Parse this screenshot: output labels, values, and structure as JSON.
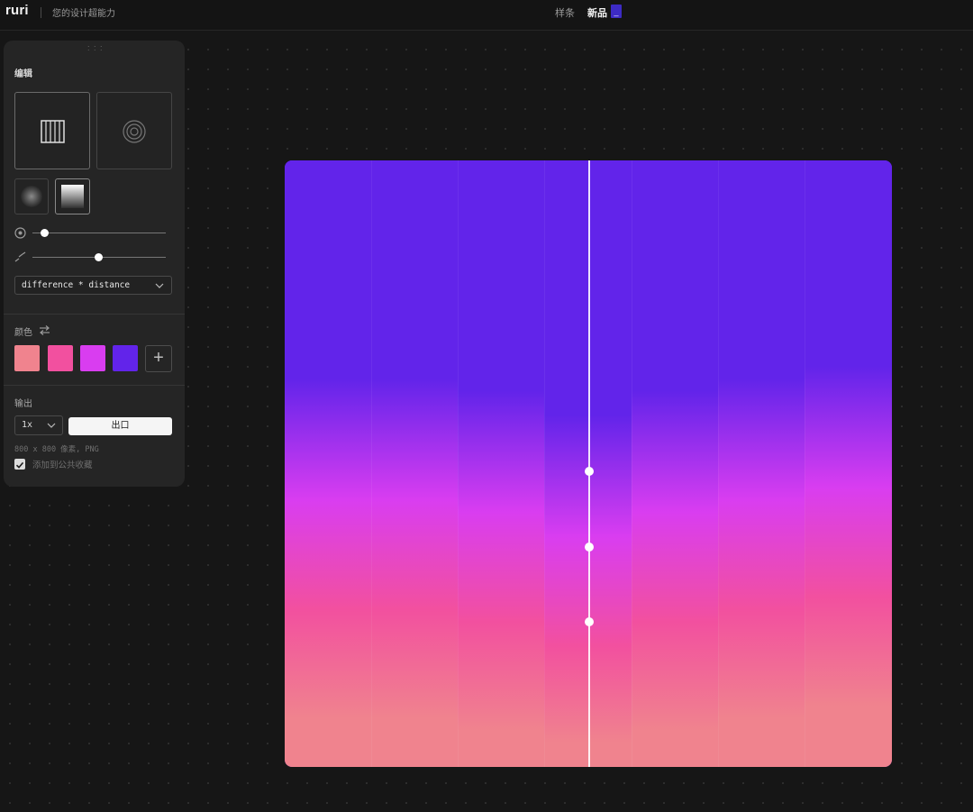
{
  "header": {
    "logo": "ruri",
    "tagline": "您的设计超能力",
    "nav": [
      {
        "label": "样条"
      },
      {
        "label": "新品"
      }
    ],
    "badge": "_"
  },
  "panel": {
    "edit_title": "编辑",
    "modes": [
      {
        "name": "vertical-strips-icon",
        "active": true
      },
      {
        "name": "concentric-rings-icon",
        "active": false
      }
    ],
    "textures": [
      {
        "name": "blur-texture-icon"
      },
      {
        "name": "linear-gradient-texture-icon",
        "active": true
      }
    ],
    "sliders": [
      {
        "icon": "radius-icon",
        "level": 0.08
      },
      {
        "icon": "stepped-lines-icon",
        "level": 0.5
      }
    ],
    "blend_select": "difference * distance",
    "colors_title": "颜色",
    "colors": [
      "#f0838e",
      "#f2509f",
      "#d93df0",
      "#6224ea"
    ],
    "add_color_label": "+",
    "output_title": "输出",
    "scale_select": "1x",
    "export_label": "出口",
    "meta": "800 x 800 像素, PNG",
    "public_label": "添加到公共收藏",
    "public_checked": true
  },
  "canvas": {
    "strip_count": 7,
    "guide_handles": 3
  }
}
